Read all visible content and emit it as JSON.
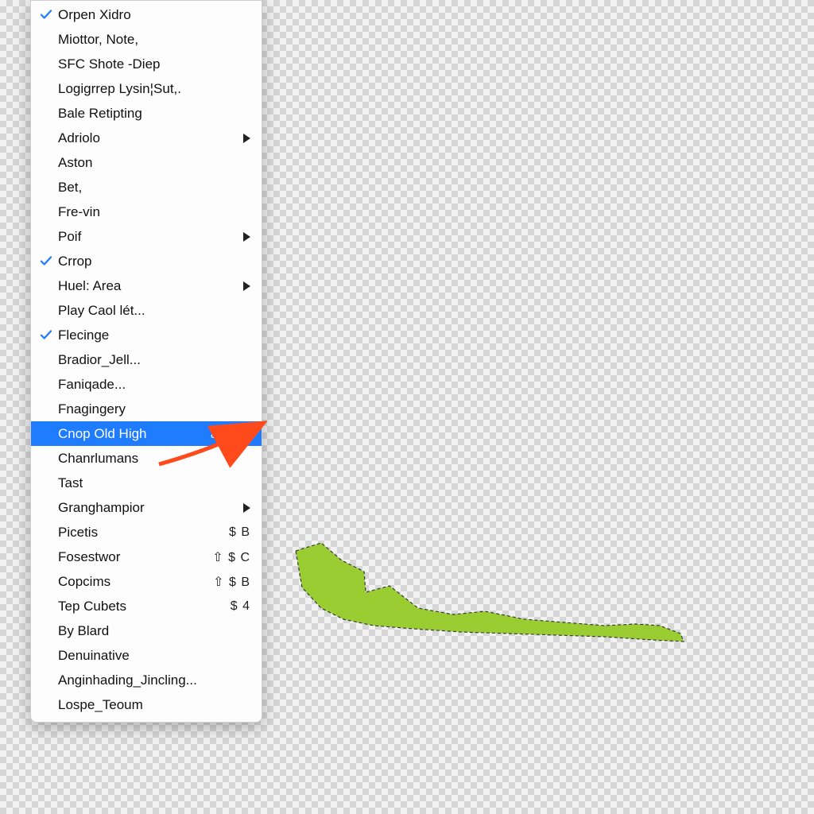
{
  "colors": {
    "highlight": "#1f7cff",
    "shapeFill": "#9acd32",
    "arrow": "#ff4a1c"
  },
  "menu": {
    "items": [
      {
        "label": "Orpen Xidro",
        "checked": true
      },
      {
        "label": "Miottor, Note,"
      },
      {
        "label": "SFC Shote -Diep"
      },
      {
        "label": "Logigrrep Lysin¦Sut,."
      },
      {
        "label": "Bale Retipting"
      },
      {
        "label": "Adriolo",
        "submenu": true
      },
      {
        "label": "Aston"
      },
      {
        "label": "Bet,"
      },
      {
        "label": "Fre-vin"
      },
      {
        "label": "Poif",
        "submenu": true
      },
      {
        "label": "Crrop",
        "checked": true
      },
      {
        "label": "Huel: Area",
        "submenu": true
      },
      {
        "label": "Play Caol lét..."
      },
      {
        "label": "Flecinge",
        "checked": true
      },
      {
        "label": "Bradior_Jell..."
      },
      {
        "label": "Faniqade..."
      },
      {
        "label": "Fnagingery"
      },
      {
        "label": "Cnop Old High",
        "shortcut": "⌘ $",
        "submenu": true,
        "highlight": true
      },
      {
        "label": "Chanrlumans"
      },
      {
        "label": "Tast"
      },
      {
        "label": "Granghampior",
        "submenu": true
      },
      {
        "label": "Picetis",
        "shortcut": "$ B"
      },
      {
        "label": "Fosestwor",
        "shortcut": "⇧ $ C"
      },
      {
        "label": "Copcims",
        "shortcut": "⇧ $ B"
      },
      {
        "label": "Tep Cubets",
        "shortcut": "$ 4"
      },
      {
        "label": "By Blard"
      },
      {
        "label": "Denuinative"
      },
      {
        "label": "Anginhading_Jincling..."
      },
      {
        "label": "Lospe_Teoum"
      }
    ]
  }
}
